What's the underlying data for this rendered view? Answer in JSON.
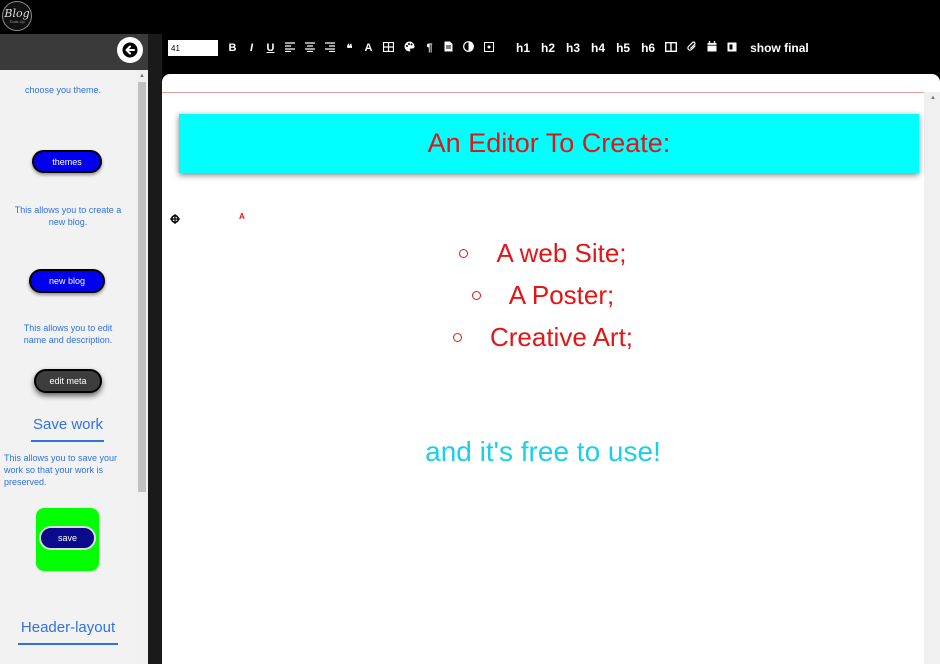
{
  "logo": {
    "main": "Blog",
    "sub": "Tools Up"
  },
  "sidebar": {
    "themes_desc": "choose you theme.",
    "themes_label": "themes",
    "new_blog_desc": "This allows you to create a new blog.",
    "new_blog_label": "new blog",
    "edit_meta_desc": "This allows you to edit name and description.",
    "edit_meta_label": "edit meta",
    "save_title": "Save work",
    "save_desc": "This allows you to save your work so that your work is preserved.",
    "save_label": "save",
    "header_layout_title": "Header-layout"
  },
  "toolbar": {
    "font_size": "41",
    "bold": "B",
    "italic": "I",
    "underline": "U",
    "quote": "❝",
    "font_color": "A",
    "pilcrow": "¶",
    "h1": "h1",
    "h2": "h2",
    "h3": "h3",
    "h4": "h4",
    "h5": "h5",
    "h6": "h6",
    "show_final": "show final"
  },
  "editor": {
    "heading": "An Editor To Create:",
    "marker": "A",
    "list_items": [
      "A web Site;",
      "A Poster;",
      "Creative Art;"
    ],
    "tagline": "and it's free to use!"
  },
  "colors": {
    "accent_blue": "#2f72e0",
    "heading_bg": "#00ffff",
    "heading_text": "#e21616",
    "tagline": "#1ccfe8",
    "save_bg": "#00ff00"
  },
  "icons": [
    "arrow-left-icon",
    "align-left-icon",
    "align-center-icon",
    "align-right-icon",
    "table-icon",
    "palette-icon",
    "file-icon",
    "contrast-icon",
    "image-icon",
    "columns-icon",
    "paperclip-icon",
    "calendar-icon",
    "card-icon",
    "crosshair-icon"
  ]
}
